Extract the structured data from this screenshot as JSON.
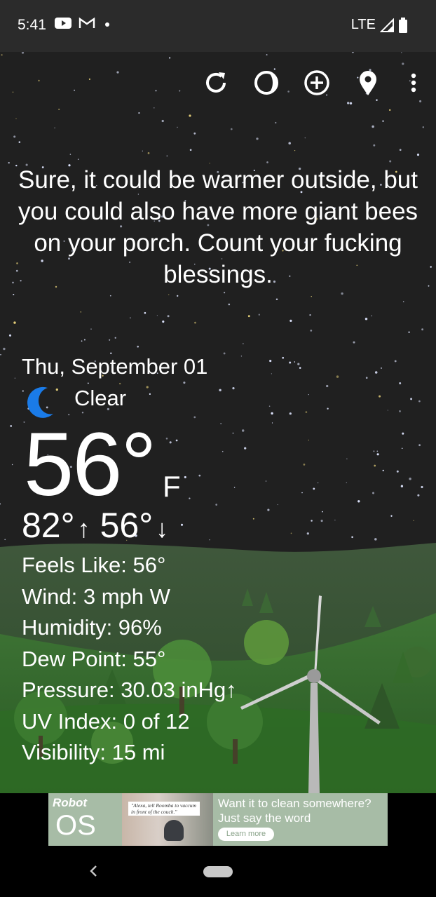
{
  "status_bar": {
    "time": "5:41",
    "network": "LTE",
    "icons": [
      "youtube-icon",
      "gmail-icon",
      "notification-dot-icon",
      "signal-icon",
      "battery-icon"
    ]
  },
  "toolbar": {
    "icons": [
      "refresh-icon",
      "moon-phase-icon",
      "add-location-icon",
      "location-pin-icon",
      "more-vert-icon"
    ]
  },
  "quote": "Sure, it could be warmer outside, but you could also have more giant bees on your porch. Count your fucking blessings.",
  "weather": {
    "date": "Thu, September 01",
    "condition": "Clear",
    "condition_icon": "moon-icon",
    "temperature": "56°",
    "unit": "F",
    "high": "82°",
    "low": "56°",
    "details": [
      "Feels Like:  56°",
      "Wind:  3 mph W",
      "Humidity:  96%",
      "Dew Point:  55°",
      "Pressure:  30.03 inHg↑",
      "UV Index:  0 of 12",
      "Visibility:  15 mi"
    ]
  },
  "ad": {
    "brand": "Robot",
    "brand_os": "OS",
    "quote": "\"Alexa, tell Roomba to vaccum in front of the couch.\"",
    "headline": "Want it to clean somewhere? Just say the word",
    "cta": "Learn more"
  },
  "colors": {
    "sky": "#202020",
    "hills": "#2f5a2b",
    "moon": "#1a7be8",
    "ad_bg": "#a7bca6"
  }
}
